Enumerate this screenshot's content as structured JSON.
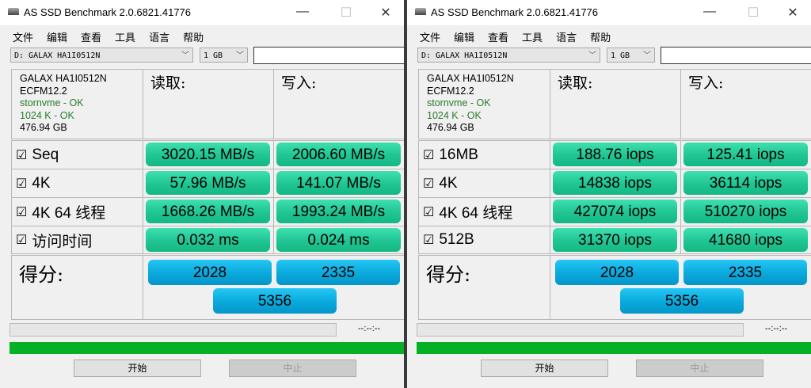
{
  "windows": [
    {
      "title": "AS SSD Benchmark 2.0.6821.41776",
      "menu": [
        "文件",
        "编辑",
        "查看",
        "工具",
        "语言",
        "帮助"
      ],
      "drive": "D: GALAX HA1I0512N",
      "size": "1 GB",
      "info": {
        "model": "GALAX HA1I0512N",
        "firmware": "ECFM12.2",
        "driver": "stornvme - OK",
        "align": "1024 K - OK",
        "capacity": "476.94 GB"
      },
      "read_label": "读取:",
      "write_label": "写入:",
      "rows": [
        {
          "label": "Seq",
          "read": "3020.15 MB/s",
          "write": "2006.60 MB/s"
        },
        {
          "label": "4K",
          "read": "57.96 MB/s",
          "write": "141.07 MB/s"
        },
        {
          "label": "4K 64 线程",
          "read": "1668.26 MB/s",
          "write": "1993.24 MB/s"
        },
        {
          "label": "访问时间",
          "read": "0.032 ms",
          "write": "0.024 ms"
        }
      ],
      "score_label": "得分:",
      "score_read": "2028",
      "score_write": "2335",
      "score_total": "5356",
      "timer": "--:--:--",
      "progress_percent": 100,
      "start": "开始",
      "stop": "中止"
    },
    {
      "title": "AS SSD Benchmark 2.0.6821.41776",
      "menu": [
        "文件",
        "编辑",
        "查看",
        "工具",
        "语言",
        "帮助"
      ],
      "drive": "D: GALAX HA1I0512N",
      "size": "1 GB",
      "info": {
        "model": "GALAX HA1I0512N",
        "firmware": "ECFM12.2",
        "driver": "stornvme - OK",
        "align": "1024 K - OK",
        "capacity": "476.94 GB"
      },
      "read_label": "读取:",
      "write_label": "写入:",
      "rows": [
        {
          "label": "16MB",
          "read": "188.76 iops",
          "write": "125.41 iops"
        },
        {
          "label": "4K",
          "read": "14838 iops",
          "write": "36114 iops"
        },
        {
          "label": "4K 64 线程",
          "read": "427074 iops",
          "write": "510270 iops"
        },
        {
          "label": "512B",
          "read": "31370 iops",
          "write": "41680 iops"
        }
      ],
      "score_label": "得分:",
      "score_read": "2028",
      "score_write": "2335",
      "score_total": "5356",
      "timer": "--:--:--",
      "progress_percent": 100,
      "start": "开始",
      "stop": "中止"
    }
  ],
  "checkbox_glyph": "☑"
}
